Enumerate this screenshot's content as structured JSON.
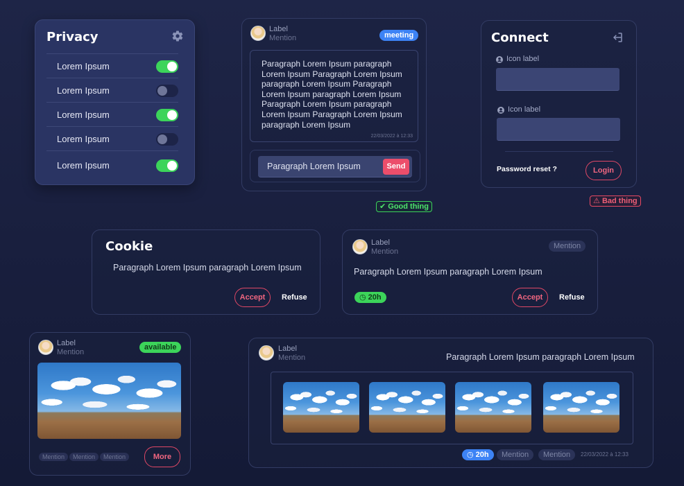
{
  "colors": {
    "accent_blue": "#3d83f5",
    "accent_green": "#3cd45a",
    "accent_red": "#e04866",
    "bg": "#191f3e"
  },
  "privacy": {
    "title": "Privacy",
    "icon": "gear-icon",
    "items": [
      {
        "label": "Lorem Ipsum",
        "on": true
      },
      {
        "label": "Lorem Ipsum",
        "on": false
      },
      {
        "label": "Lorem Ipsum",
        "on": true
      },
      {
        "label": "Lorem Ipsum",
        "on": false
      },
      {
        "label": "Lorem Ipsum",
        "on": true
      }
    ]
  },
  "chat": {
    "user_label": "Label",
    "user_mention": "Mention",
    "badge": "meeting",
    "message": "Paragraph Lorem Ipsum paragraph Lorem Ipsum Paragraph Lorem Ipsum paragraph Lorem Ipsum Paragraph Lorem Ipsum paragraph Lorem Ipsum Paragraph Lorem Ipsum paragraph Lorem Ipsum Paragraph Lorem Ipsum paragraph Lorem Ipsum",
    "timestamp": "22/03/2022 à 12:33",
    "input_value": "Paragraph Lorem Ipsum",
    "send_label": "Send",
    "status": "Good thing"
  },
  "connect": {
    "title": "Connect",
    "field1_label": "Icon label",
    "field2_label": "Icon label",
    "password_reset": "Password reset ?",
    "login_label": "Login",
    "status": "Bad thing"
  },
  "cookie": {
    "title": "Cookie",
    "text": "Paragraph Lorem Ipsum paragraph Lorem Ipsum",
    "accept_label": "Accept",
    "refuse_label": "Refuse"
  },
  "notice": {
    "user_label": "Label",
    "user_mention": "Mention",
    "tag": "Mention",
    "text": "Paragraph Lorem Ipsum paragraph Lorem Ipsum",
    "time": "20h",
    "accept_label": "Accept",
    "refuse_label": "Refuse"
  },
  "photo_card": {
    "user_label": "Label",
    "user_mention": "Mention",
    "badge": "available",
    "tags": [
      "Mention",
      "Mention",
      "Mention"
    ],
    "more_label": "More"
  },
  "gallery": {
    "user_label": "Label",
    "user_mention": "Mention",
    "text": "Paragraph Lorem Ipsum paragraph Lorem Ipsum",
    "time": "20h",
    "tags": [
      "Mention",
      "Mention"
    ],
    "timestamp": "22/03/2022 à 12:33"
  }
}
